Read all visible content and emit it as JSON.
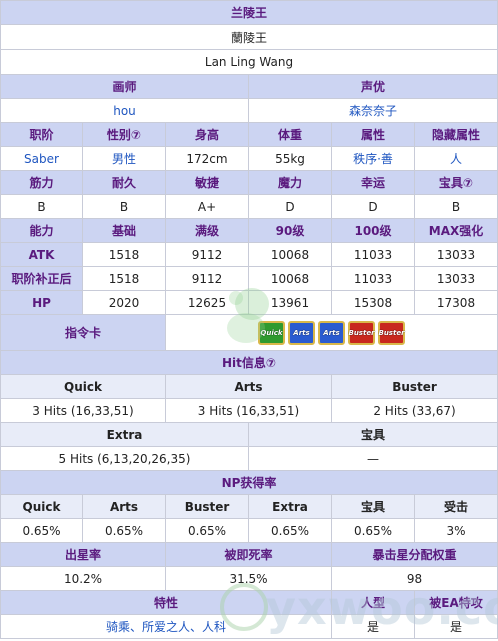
{
  "title": "兰陵王",
  "name_alt": "蘭陵王",
  "name_en": "Lan Ling Wang",
  "profile": {
    "illustrator_label": "画师",
    "cv_label": "声优",
    "illustrator": "hou",
    "cv": "森奈奈子"
  },
  "basic": {
    "headers": [
      "职阶",
      "性别⑦",
      "身高",
      "体重",
      "属性",
      "隐藏属性"
    ],
    "values": [
      "Saber",
      "男性",
      "172cm",
      "55kg",
      "秩序·善",
      "人"
    ]
  },
  "params": {
    "headers": [
      "筋力",
      "耐久",
      "敏捷",
      "魔力",
      "幸运",
      "宝具⑦"
    ],
    "values": [
      "B",
      "B",
      "A+",
      "D",
      "D",
      "B"
    ]
  },
  "stats": {
    "headers": [
      "能力",
      "基础",
      "满级",
      "90级",
      "100级",
      "MAX强化"
    ],
    "rows": [
      {
        "label": "ATK",
        "values": [
          "1518",
          "9112",
          "10068",
          "11033",
          "13033"
        ]
      },
      {
        "label": "职阶补正后",
        "values": [
          "1518",
          "9112",
          "10068",
          "11033",
          "13033"
        ]
      },
      {
        "label": "HP",
        "values": [
          "2020",
          "12625",
          "13961",
          "15308",
          "17308"
        ]
      }
    ]
  },
  "command_cards": {
    "label": "指令卡",
    "cards": [
      {
        "type": "Quick",
        "color": "#2f9a2f"
      },
      {
        "type": "Arts",
        "color": "#2a5bd0"
      },
      {
        "type": "Arts",
        "color": "#2a5bd0"
      },
      {
        "type": "Buster",
        "color": "#c8281e"
      },
      {
        "type": "Buster",
        "color": "#c8281e"
      }
    ]
  },
  "hits": {
    "title": "Hit信息⑦",
    "headers": [
      "Quick",
      "Arts",
      "Buster"
    ],
    "values": [
      "3 Hits (16,33,51)",
      "3 Hits (16,33,51)",
      "2 Hits (33,67)"
    ],
    "headers2": [
      "Extra",
      "宝具"
    ],
    "values2": [
      "5 Hits (6,13,20,26,35)",
      "—"
    ]
  },
  "np": {
    "title": "NP获得率",
    "headers": [
      "Quick",
      "Arts",
      "Buster",
      "Extra",
      "宝具",
      "受击"
    ],
    "values": [
      "0.65%",
      "0.65%",
      "0.65%",
      "0.65%",
      "0.65%",
      "3%"
    ]
  },
  "star": {
    "headers": [
      "出星率",
      "被即死率",
      "暴击星分配权重"
    ],
    "values": [
      "10.2%",
      "31.5%",
      "98"
    ]
  },
  "traits": {
    "headers": [
      "特性",
      "人型",
      "被EA特攻"
    ],
    "values": [
      "骑乘、所爱之人、人科",
      "是",
      "是"
    ]
  },
  "watermark": "yxwoo.com"
}
